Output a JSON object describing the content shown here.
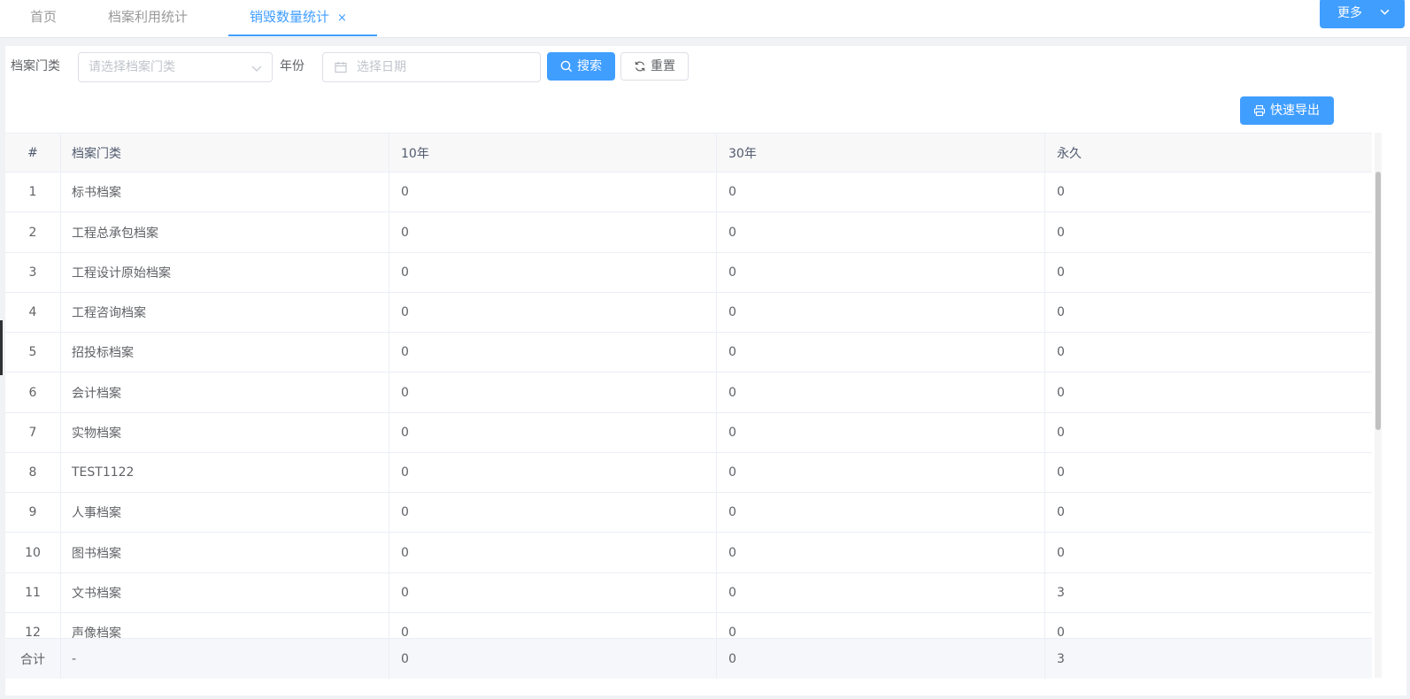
{
  "tabs": [
    {
      "label": "首页",
      "active": false
    },
    {
      "label": "档案利用统计",
      "active": false
    },
    {
      "label": "销毁数量统计",
      "active": true,
      "close": "×"
    }
  ],
  "more_label": "更多",
  "filters": {
    "category_label": "档案门类",
    "category_placeholder": "请选择档案门类",
    "year_label": "年份",
    "date_placeholder": "选择日期"
  },
  "buttons": {
    "search": "搜索",
    "reset": "重置",
    "export": "快速导出"
  },
  "table": {
    "columns": [
      "#",
      "档案门类",
      "10年",
      "30年",
      "永久"
    ],
    "rows": [
      [
        "1",
        "标书档案",
        "0",
        "0",
        "0"
      ],
      [
        "2",
        "工程总承包档案",
        "0",
        "0",
        "0"
      ],
      [
        "3",
        "工程设计原始档案",
        "0",
        "0",
        "0"
      ],
      [
        "4",
        "工程咨询档案",
        "0",
        "0",
        "0"
      ],
      [
        "5",
        "招投标档案",
        "0",
        "0",
        "0"
      ],
      [
        "6",
        "会计档案",
        "0",
        "0",
        "0"
      ],
      [
        "7",
        "实物档案",
        "0",
        "0",
        "0"
      ],
      [
        "8",
        "TEST1122",
        "0",
        "0",
        "0"
      ],
      [
        "9",
        "人事档案",
        "0",
        "0",
        "0"
      ],
      [
        "10",
        "图书档案",
        "0",
        "0",
        "0"
      ],
      [
        "11",
        "文书档案",
        "0",
        "0",
        "3"
      ],
      [
        "12",
        "声像档案",
        "0",
        "0",
        "0"
      ]
    ],
    "footer": [
      "合计",
      "-",
      "0",
      "0",
      "3"
    ]
  },
  "colors": {
    "primary": "#409eff",
    "border": "#ebeef5"
  }
}
